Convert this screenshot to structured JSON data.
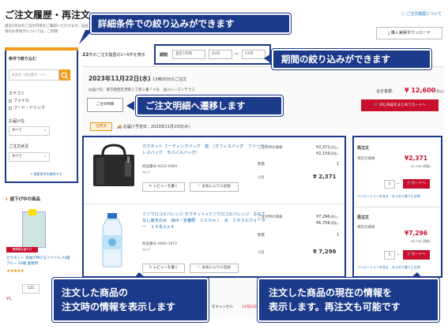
{
  "header": {
    "title": "ご注文履歴・再注文",
    "description": "過去5年分のご注文内容をご確認いただけます。返品等のお手続きについては、ご利用",
    "help_link": "ご注文履歴について",
    "csv_button": "購入実績ダウンロード"
  },
  "sidebar": {
    "title": "条件で絞り込む",
    "search_placeholder": "商品名・商品番号・ﾒｰｶｰ",
    "category_label": "カテゴリ",
    "categories": [
      "ファイル",
      "フード・ドリンク"
    ],
    "delivery_label": "お届け先",
    "delivery_value": "すべて",
    "status_label": "ご注文状況",
    "status_value": "すべて",
    "clear_link": "× 検索条件を解除する"
  },
  "price_drop": {
    "title": "値下げ中の商品",
    "tag": "期間限定値下げ",
    "product_name": "カウネット 背幅が伸びるファイル A4縦 ブルー 20冊 業務用",
    "stars": "★★★★★",
    "qty": "123",
    "price": "¥1,"
  },
  "main": {
    "count_number": "22",
    "count_text": "件のご注文履歴の1〜5件を表示",
    "period_label": "期間",
    "period_preset": "直近1年間",
    "period_from": "01月",
    "period_tilde": "〜",
    "period_to": "01月"
  },
  "order": {
    "date": "2023年11月22日(水)",
    "time_suffix": "13時20分のご注文",
    "address": "お届け先：東京都西区港南１丁目２番７０号　品川シーズンテラス",
    "total_label": "合計金額：",
    "total_price": "¥ 12,600",
    "total_tax": "(税込)",
    "reorder_all_button": "同じ商品をまとめてカートへ",
    "detail_button": "ご注文明細",
    "shipped_badge": "出荷済",
    "delivery_date": "お届け予定日：2023年11月23日(木)"
  },
  "items": [
    {
      "name": "カウネット ミーティングバッグ　黒　（オフィスバッグ　フリーアドレスバッグ　モバイルバッグ）",
      "code": "商品番号-4222-9384",
      "maker": "ｲﾒｰｼﾞ",
      "price_label": "ご注文時の価格",
      "price_incl": "¥2,371",
      "price_excl": "¥2,156",
      "tax_incl": "(税込)",
      "tax_excl": "(税抜)",
      "qty_label": "数量",
      "qty": "1",
      "subtotal_label": "小計",
      "subtotal": "¥ 2,371",
      "review": "レビューを書く",
      "favorite": "お気に入りに追加",
      "ro_title": "再注文",
      "ro_price_label": "現在の価格",
      "ro_price": "¥2,371",
      "ro_sub": "¥2,156 (税抜)",
      "ro_qty": "1",
      "ro_cart": "カートへ",
      "ro_links": "バリエーションを見る　まとめて買うとお得"
    },
    {
      "name": "ミツウロコビバレッジ カウネット×ミツウロコビバレッジ　おもてなし南天の水　信州・安曇野　３５０ｍｌ　水　ミネラルウォーター　２４本入×４",
      "code": "商品番号-4660-1872",
      "maker": "ｲﾒｰｼﾞ",
      "price_label": "ご注文時の価格",
      "price_incl": "¥7,296",
      "price_excl": "¥6,756",
      "tax_incl": "(税込)",
      "tax_excl": "(税抜)",
      "qty_label": "数量",
      "qty": "1",
      "subtotal_label": "小計",
      "subtotal": "¥ 7,296",
      "review": "レビューを書く",
      "favorite": "お気に入りに追加",
      "ro_title": "再注文",
      "ro_price_label": "現在の価格",
      "ro_price": "¥7,296",
      "ro_sub": "¥6,756 (税抜)",
      "ro_qty": "1",
      "ro_cart": "カートへ",
      "ro_links": "バリエーションを見る　まとめて買うとお得"
    }
  ],
  "bottom": {
    "cancel": "をキャンセル",
    "date_snippet": "11月22日"
  },
  "callouts": {
    "filter": "詳細条件での絞り込みができます",
    "period": "期間の絞り込みができます",
    "detail": "ご注文明細へ遷移します",
    "items_line1": "注文した商品の",
    "items_line2": "注文時の情報を表示します",
    "reorder_line1": "注文した商品の現在の情報を",
    "reorder_line2": "表示します。再注文も可能です"
  },
  "colors": {
    "accent": "#1c3a8a",
    "orange": "#f29a1a",
    "red": "#c8102e",
    "link": "#1a6fb5"
  }
}
